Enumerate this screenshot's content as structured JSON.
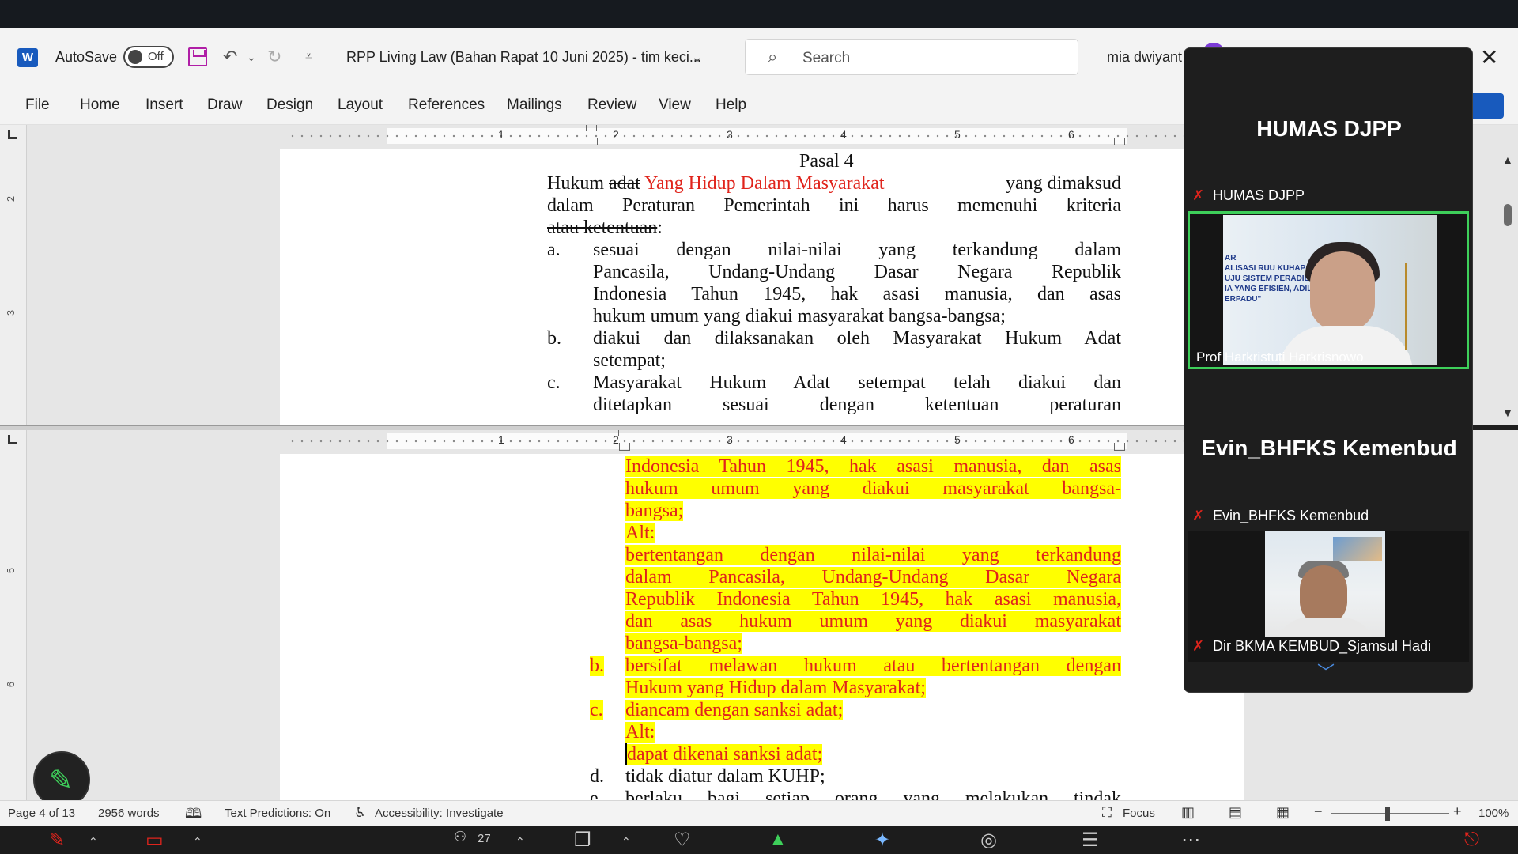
{
  "window": {
    "app_logo_letter": "W",
    "autosave_label": "AutoSave",
    "autosave_state": "Off",
    "doc_title": "RPP Living Law (Bahan Rapat 10 Juni 2025) - tim keci...",
    "search_placeholder": "Search",
    "user_name": "mia dwiyant"
  },
  "menu": [
    "File",
    "Home",
    "Insert",
    "Draw",
    "Design",
    "Layout",
    "References",
    "Mailings",
    "Review",
    "View",
    "Help"
  ],
  "ruler": {
    "numbers": [
      "1",
      "2",
      "3",
      "4",
      "5",
      "6"
    ],
    "vnumbers_top": [
      "2",
      "3"
    ],
    "vnumbers_bottom": [
      "5",
      "6"
    ]
  },
  "top_pane": {
    "heading": "Pasal 4",
    "line1_a": "Hukum ",
    "line1_strike": "adat",
    "line1_red": "Yang Hidup Dalam Masyarakat",
    "line1_b": "yang dimaksud",
    "line2": "dalam Peraturan Pemerintah ini harus memenuhi kriteria",
    "line3_strike": "atau ketentuan",
    "line3_end": ":",
    "item_a_marker": "a.",
    "item_a_lines": [
      "sesuai dengan nilai-nilai yang terkandung dalam",
      "Pancasila, Undang-Undang Dasar Negara Republik",
      "Indonesia Tahun 1945, hak asasi manusia, dan asas",
      "hukum umum yang diakui masyarakat bangsa-bangsa;"
    ],
    "item_b_marker": "b.",
    "item_b_lines": [
      "diakui dan dilaksanakan oleh Masyarakat Hukum Adat",
      "setempat;"
    ],
    "item_c_marker": "c.",
    "item_c_lines": [
      "Masyarakat Hukum Adat setempat telah diakui dan",
      "ditetapkan sesuai dengan ketentuan peraturan"
    ]
  },
  "bottom_pane": {
    "hl_lines_1": [
      "Indonesia Tahun 1945, hak asasi manusia, dan asas",
      "hukum umum yang diakui masyarakat bangsa-",
      "bangsa;"
    ],
    "alt_label": "Alt:",
    "hl_lines_2": [
      "bertentangan dengan nilai-nilai yang terkandung",
      "dalam Pancasila, Undang-Undang Dasar Negara",
      "Republik Indonesia Tahun 1945, hak asasi manusia,",
      "dan asas hukum umum yang diakui masyarakat",
      "bangsa-bangsa;"
    ],
    "item_b_marker": "b.",
    "item_b_lines": [
      "bersifat melawan hukum atau bertentangan dengan",
      "Hukum yang Hidup dalam Masyarakat;"
    ],
    "item_c_marker": "c.",
    "item_c_line": "diancam dengan sanksi adat;",
    "alt_label_2": "Alt:",
    "alt_line_2": "dapat dikenai sanksi adat;",
    "item_d_marker": "d.",
    "item_d_line": "tidak diatur dalam KUHP;",
    "item_e_marker": "e.",
    "item_e_line": "berlaku bagi setiap orang yang melakukan tindak"
  },
  "video_panel": {
    "title_1": "HUMAS DJPP",
    "label_1": "HUMAS DJPP",
    "tile_1_name": "Prof Harkristuti Harkrisnowo",
    "tile_1_slide": [
      "AR",
      "ALISASI RUU KUHAP:",
      "UJU SISTEM PERADILA",
      "IA YANG EFISIEN, ADIL,",
      "ERPADU\""
    ],
    "title_2": "Evin_BHFKS Kemenbud",
    "label_2": "Evin_BHFKS Kemenbud",
    "tile_2_name": "Dir BKMA KEMBUD_Sjamsul Hadi"
  },
  "status": {
    "page": "Page 4 of 13",
    "words": "2956 words",
    "predictions": "Text Predictions: On",
    "accessibility": "Accessibility: Investigate",
    "focus": "Focus",
    "zoom": "100%"
  },
  "taskbar": {
    "participants_count": "27"
  },
  "colors": {
    "accent": "#185abd",
    "highlight": "#ffff00",
    "revision_red": "#e0241c",
    "active_speaker": "#3ecf5a"
  }
}
